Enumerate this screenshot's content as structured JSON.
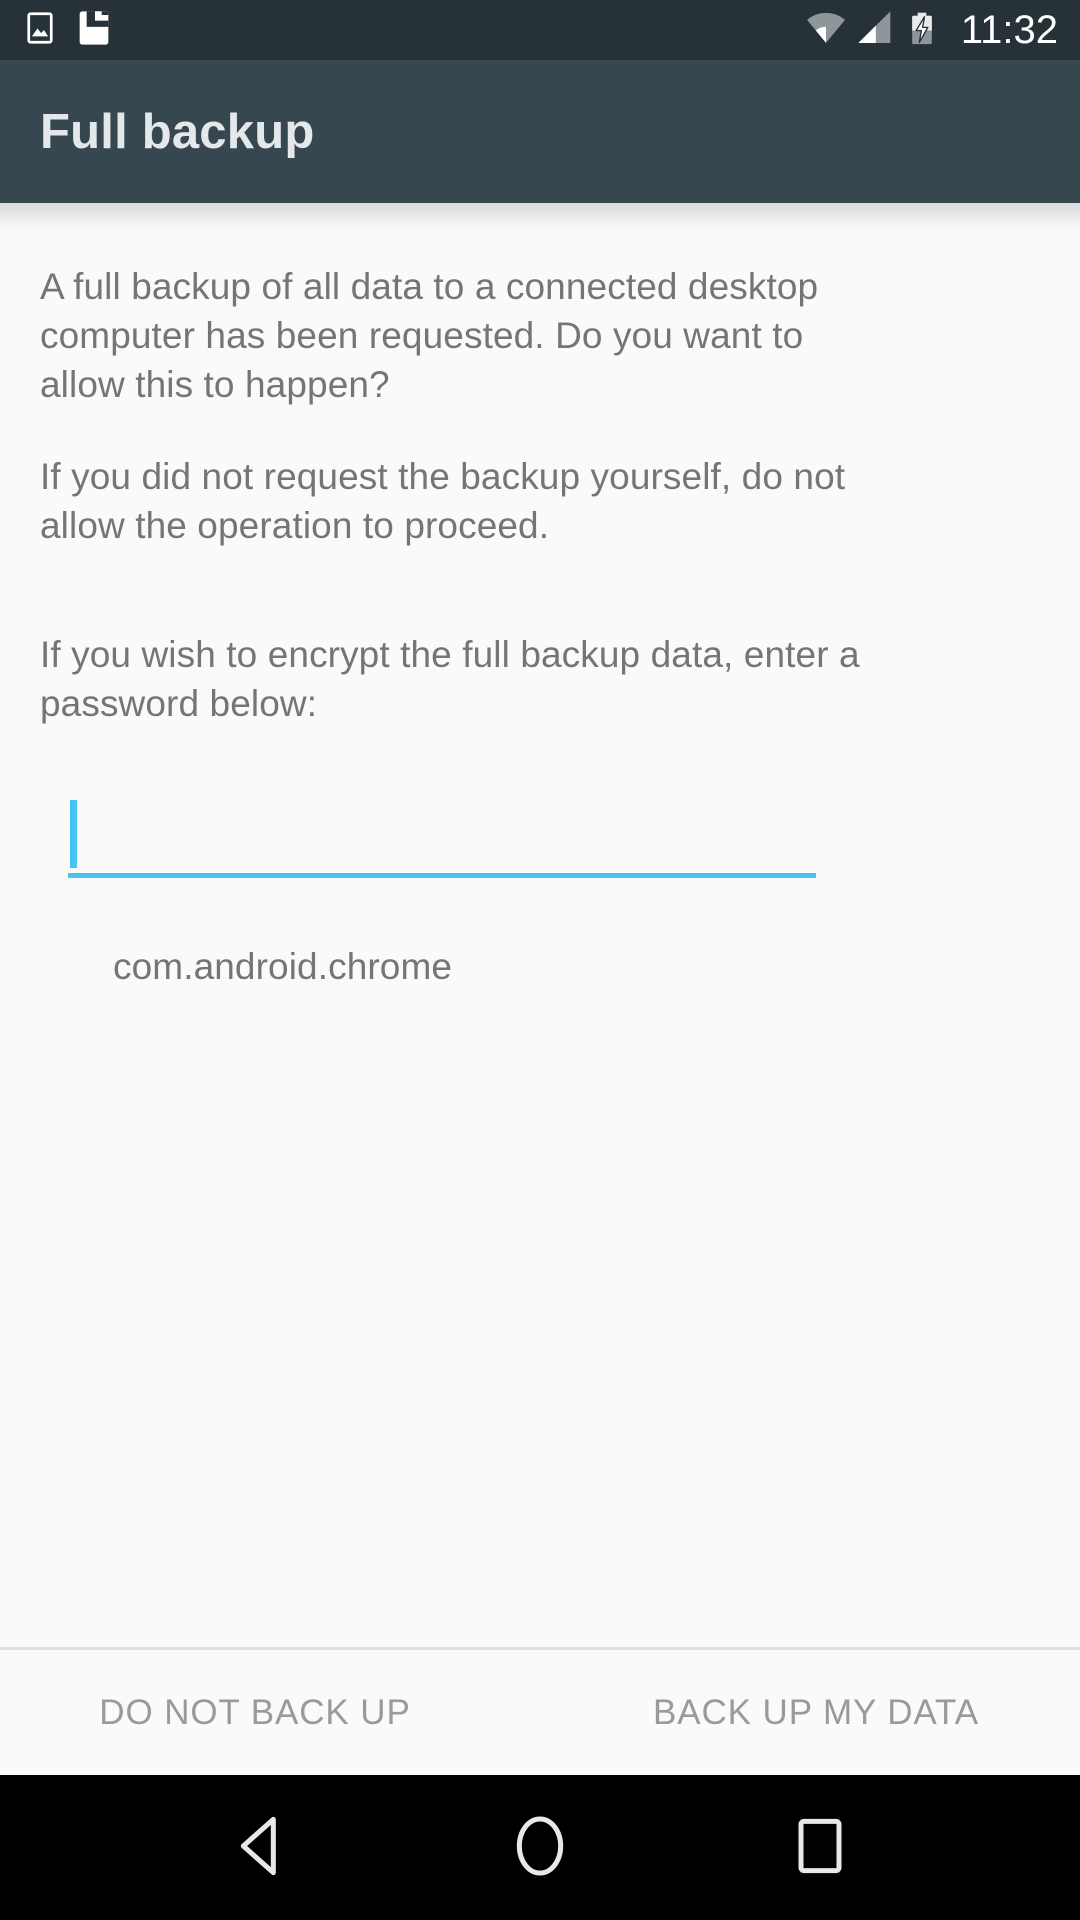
{
  "status_bar": {
    "clock": "11:32",
    "left_icons": [
      "image-icon",
      "save-card-icon"
    ],
    "right_icons": [
      "wifi-icon",
      "cellular-signal-icon",
      "battery-charging-icon"
    ],
    "background_color": "#263238",
    "foreground_color": "#FFFFFF"
  },
  "app_bar": {
    "title": "Full backup",
    "background_color": "#37474F",
    "title_color": "#E4E8EA"
  },
  "content": {
    "paragraph_1": "A full backup of all data to a connected desktop computer has been requested. Do you want to allow this to happen?",
    "paragraph_2": "If you did not request the backup yourself, do not allow the operation to proceed.",
    "paragraph_3": "If you wish to encrypt the full backup data, enter a password below:",
    "text_color": "#757575",
    "background_color": "#FAFAFA",
    "password_field": {
      "value": "",
      "placeholder": "",
      "accent_color": "#45C4F4",
      "caret_visible": true
    },
    "package_name": "com.android.chrome"
  },
  "buttons": {
    "deny_label": "DO NOT BACK UP",
    "confirm_label": "BACK UP MY DATA",
    "label_color": "#9A9A9A",
    "divider_color": "#E0E0E0"
  },
  "nav_bar": {
    "background_color": "#000000",
    "items": [
      {
        "name": "back-icon"
      },
      {
        "name": "home-icon"
      },
      {
        "name": "recents-icon"
      }
    ]
  }
}
